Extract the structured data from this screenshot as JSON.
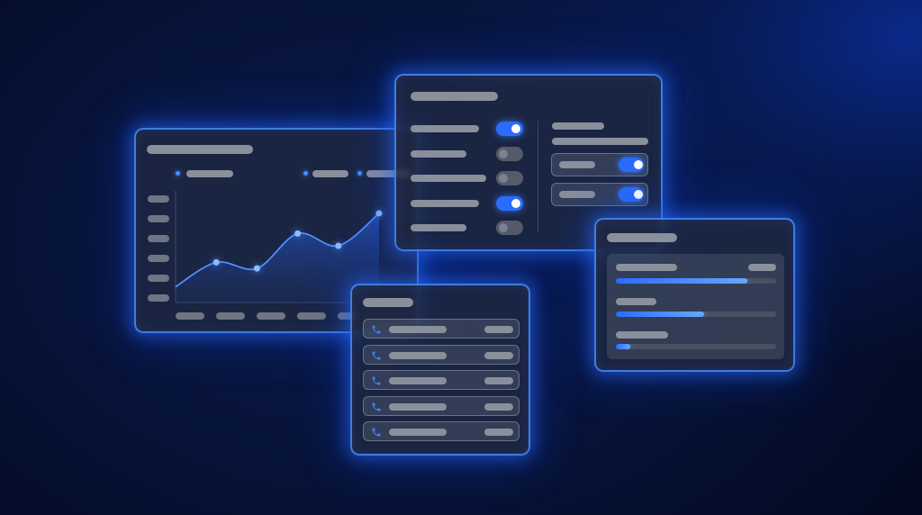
{
  "colors": {
    "accent": "#2b6cff",
    "panel_border": "#468cff",
    "placeholder_bar": "#8a8f9c",
    "background": "#071338"
  },
  "chart_panel": {
    "chart_data": {
      "type": "area",
      "points_relative": [
        0.08,
        0.48,
        0.38,
        0.95,
        0.75,
        1.28
      ],
      "markers_at": [
        1,
        2,
        3,
        4,
        5
      ],
      "legend_markers": 3
    }
  },
  "settings_panel": {
    "toggles_left": [
      true,
      false,
      false,
      true,
      false
    ],
    "toggles_right": [
      true,
      true
    ]
  },
  "contacts_panel": {
    "rows": [
      {
        "icon": "phone-icon"
      },
      {
        "icon": "phone-icon"
      },
      {
        "icon": "phone-icon"
      },
      {
        "icon": "phone-icon"
      },
      {
        "icon": "phone-icon"
      }
    ]
  },
  "progress_panel": {
    "progress": [
      0.82,
      0.55,
      0.09
    ]
  }
}
